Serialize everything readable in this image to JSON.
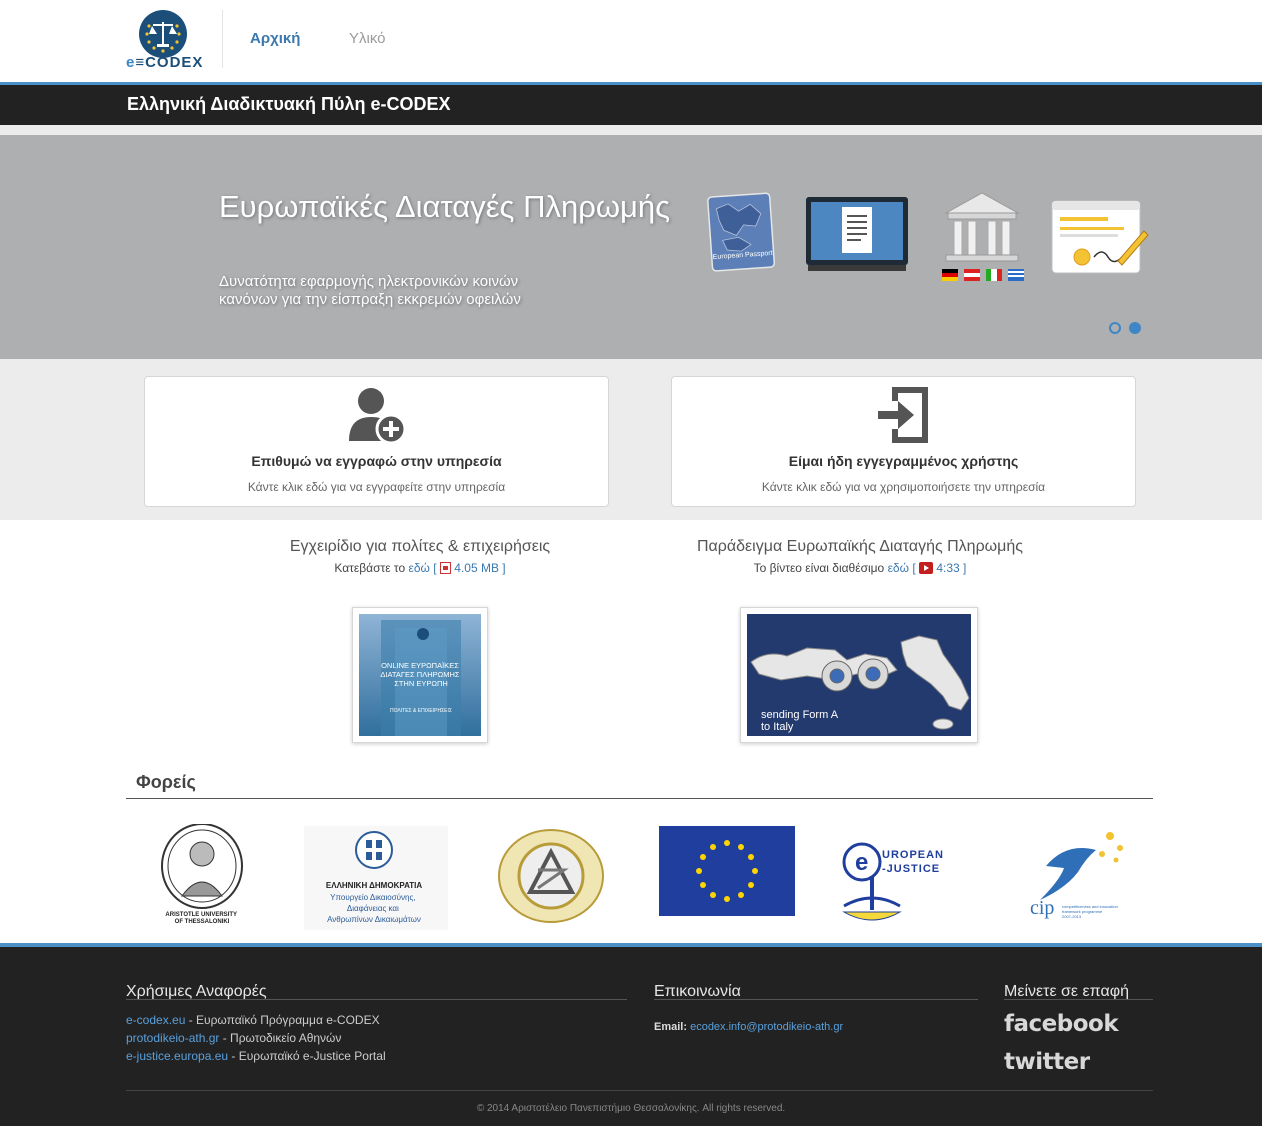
{
  "header": {
    "logo_text": "eCODEX",
    "nav": {
      "home": "Αρχική",
      "material": "Υλικό"
    },
    "site_title": "Ελληνική Διαδικτυακή Πύλη e-CODEX"
  },
  "hero": {
    "title": "Ευρωπαϊκές Διαταγές Πληρωμής",
    "description": "Δυνατότητα εφαρμογής ηλεκτρονικών κοινών κανόνων για την είσπραξη εκκρεμών οφειλών",
    "passport_label": "European Passport",
    "slides_count": 2,
    "active_slide": 2
  },
  "services": {
    "register": {
      "title": "Επιθυμώ να εγγραφώ στην υπηρεσία",
      "subtitle": "Κάντε κλικ εδώ για να εγγραφείτε στην υπηρεσία"
    },
    "login": {
      "title": "Είμαι ήδη εγγεγραμμένος χρήστης",
      "subtitle": "Κάντε κλικ εδώ για να χρησιμοποιήσετε την υπηρεσία"
    }
  },
  "resources": {
    "manual": {
      "title": "Εγχειρίδιο για πολίτες & επιχειρήσεις",
      "prefix": "Κατεβάστε το",
      "link": "εδώ",
      "size": "4.05 MB",
      "cover_text": "ONLINE ΕΥΡΩΠΑΪΚΕΣ ΔΙΑΤΑΓΕΣ ΠΛΗΡΩΜΗΣ ΣΤΗΝ ΕΥΡΩΠΗ",
      "cover_subtext": "ΠΟΛΙΤΕΣ & ΕΠΙΧΕΙΡΗΣΕΙΣ"
    },
    "video": {
      "title": "Παράδειγμα Ευρωπαϊκής Διαταγής Πληρωμής",
      "prefix": "Το βίντεο είναι διαθέσιμο",
      "link": "εδώ",
      "duration": "4:33",
      "caption": "sending Form A to Italy"
    }
  },
  "partners": {
    "title": "Φορείς",
    "auth_label": "ARISTOTLE UNIVERSITY OF THESSALONIKI",
    "gr_ministry_title": "ΕΛΛΗΝΙΚΗ ΔΗΜΟΚΡΑΤΙΑ",
    "gr_ministry_sub": "Υπουργείο Δικαιοσύνης, Διαφάνειας και Ανθρωπίνων Δικαιωμάτων",
    "ejustice_label": "EUROPEAN JUSTICE",
    "cip_label": "cip",
    "cip_sub": "competitiveness and innovation framework programme 2007-2013"
  },
  "footer": {
    "useful_title": "Χρήσιμες Αναφορές",
    "links": [
      {
        "url": "e-codex.eu",
        "desc": " - Ευρωπαϊκό Πρόγραμμα e-CODEX"
      },
      {
        "url": "protodikeio-ath.gr",
        "desc": " - Πρωτοδικείο Αθηνών"
      },
      {
        "url": "e-justice.europa.eu",
        "desc": " - Ευρωπαϊκό e-Justice Portal"
      }
    ],
    "contact_title": "Επικοινωνία",
    "email_label": "Email:",
    "email": "ecodex.info@protodikeio-ath.gr",
    "social_title": "Μείνετε σε επαφή",
    "facebook": "facebook",
    "twitter": "twitter",
    "copyright": "© 2014 Αριστοτέλειο Πανεπιστήμιο Θεσσαλονίκης. All rights reserved."
  },
  "colors": {
    "accent": "#4a90c8",
    "link": "#3b78ae",
    "dark": "#222222",
    "hero_bg": "#adafb1"
  }
}
